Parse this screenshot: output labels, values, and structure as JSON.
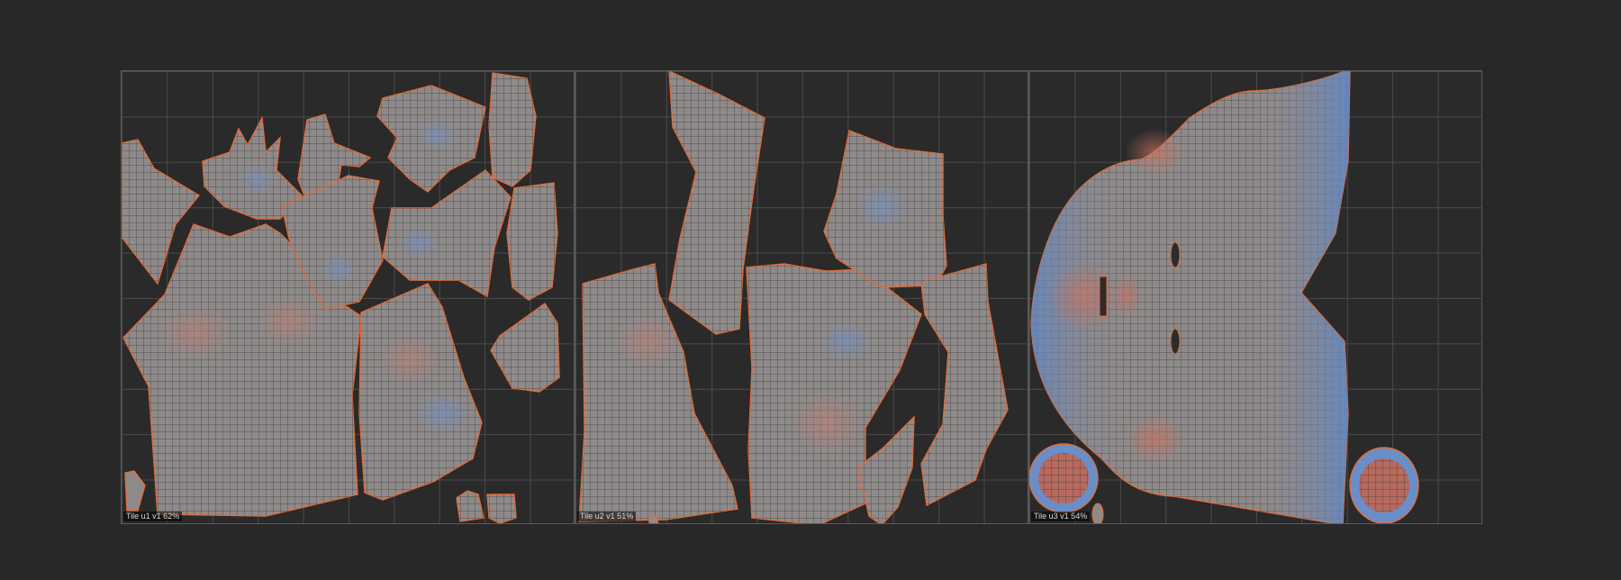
{
  "viewport": {
    "background": "#282828",
    "grid_line_color": "#4a4a4a",
    "tile_border_color": "#5a5a5a"
  },
  "colors": {
    "shell_fill": "#8f8a8a",
    "shell_outline": "#e06d3c",
    "wire": "#3a3a3a",
    "distortion_stretch": "#c87a6a",
    "distortion_compress": "#6a8ec8"
  },
  "tiles": [
    {
      "label": "Tile u1  v1  62%"
    },
    {
      "label": "Tile u2  v1  51%"
    },
    {
      "label": "Tile u3  v1  54%"
    }
  ]
}
